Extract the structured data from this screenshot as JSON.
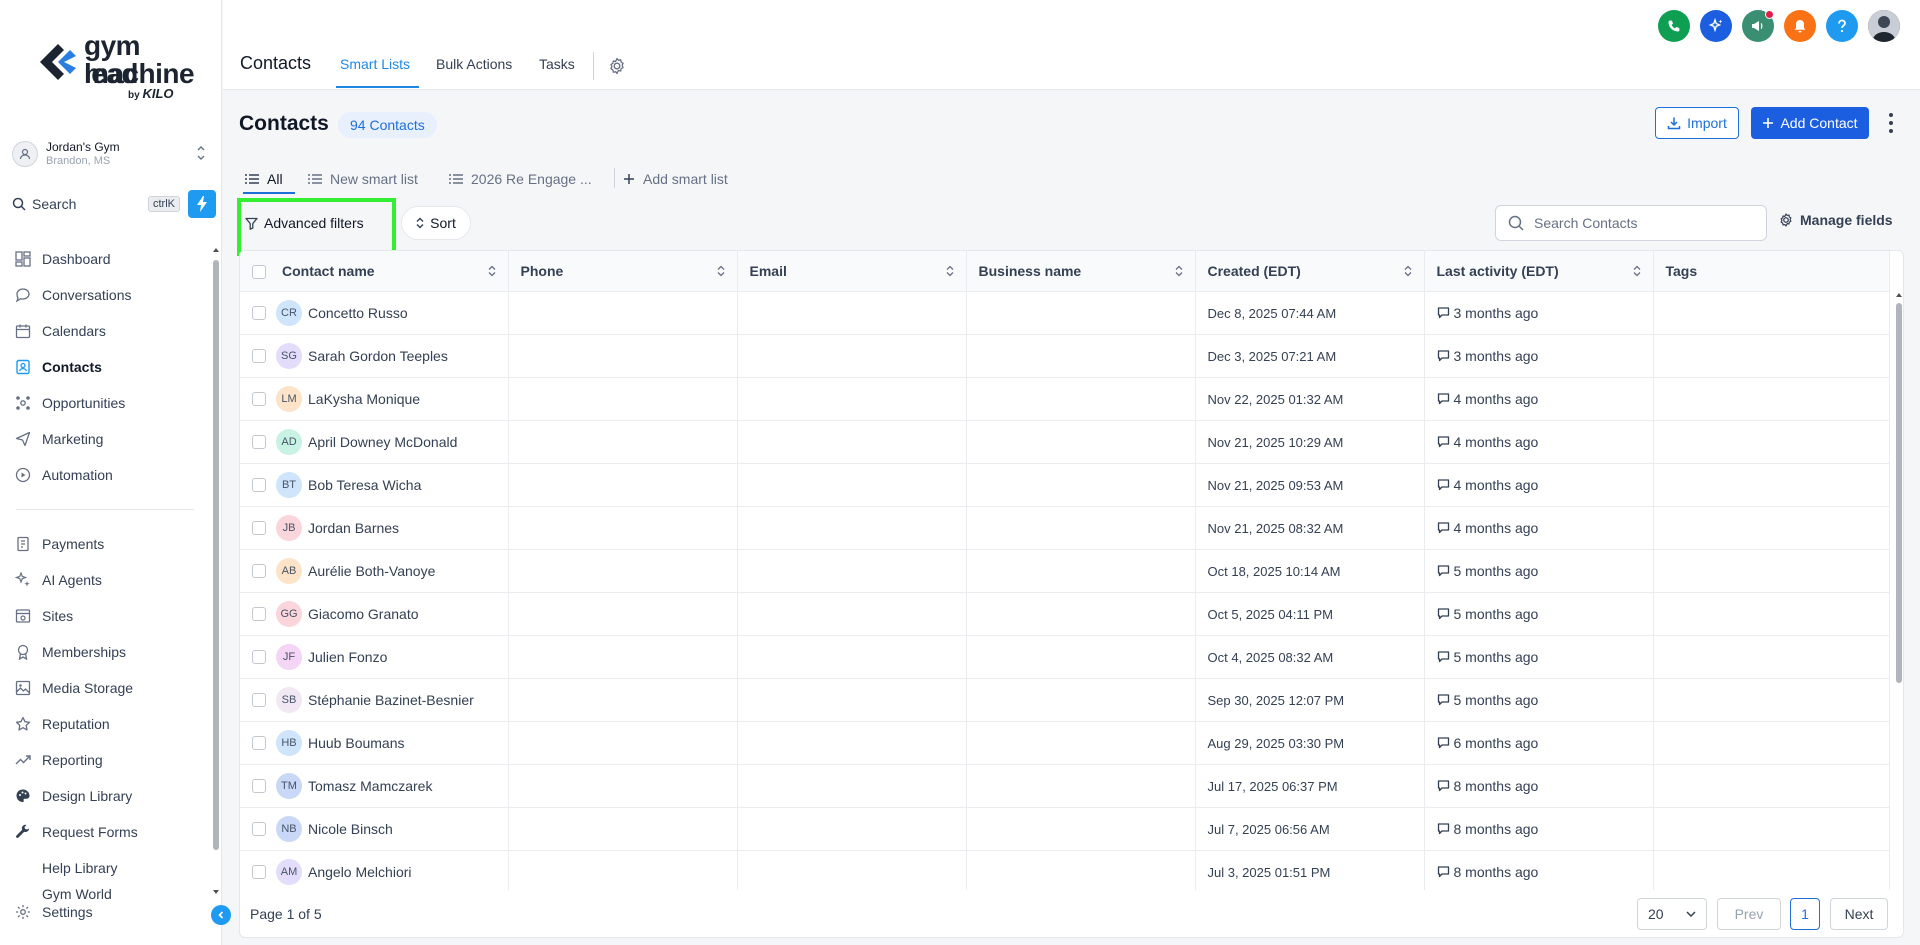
{
  "brand": {
    "line1": "gym lead",
    "line2": "machine",
    "by": "by",
    "by_brand": "KILO"
  },
  "account": {
    "name": "Jordan's Gym",
    "location": "Brandon, MS"
  },
  "sidebar_search": {
    "label": "Search",
    "shortcut": "ctrlK"
  },
  "nav_primary": [
    {
      "label": "Dashboard",
      "icon": "dashboard-icon"
    },
    {
      "label": "Conversations",
      "icon": "chat-icon"
    },
    {
      "label": "Calendars",
      "icon": "calendar-icon"
    },
    {
      "label": "Contacts",
      "icon": "contacts-icon",
      "active": true
    },
    {
      "label": "Opportunities",
      "icon": "opportunities-icon"
    },
    {
      "label": "Marketing",
      "icon": "send-icon"
    },
    {
      "label": "Automation",
      "icon": "automation-icon"
    }
  ],
  "nav_secondary": [
    {
      "label": "Payments",
      "icon": "payments-icon"
    },
    {
      "label": "AI Agents",
      "icon": "ai-agents-icon"
    },
    {
      "label": "Sites",
      "icon": "sites-icon"
    },
    {
      "label": "Memberships",
      "icon": "memberships-icon"
    },
    {
      "label": "Media Storage",
      "icon": "media-icon"
    },
    {
      "label": "Reputation",
      "icon": "star-icon"
    },
    {
      "label": "Reporting",
      "icon": "reporting-icon"
    },
    {
      "label": "Design Library",
      "icon": "palette-icon"
    },
    {
      "label": "Request Forms",
      "icon": "wrench-icon"
    },
    {
      "label": "Help Library",
      "icon": ""
    },
    {
      "label": "Gym World",
      "icon": ""
    }
  ],
  "settings_label": "Settings",
  "topbar": {
    "title": "Contacts",
    "tabs": [
      {
        "label": "Smart Lists",
        "active": true
      },
      {
        "label": "Bulk Actions"
      },
      {
        "label": "Tasks"
      }
    ],
    "icon_colors": [
      "#0e9f53",
      "#1b5fe0",
      "#3a8f73",
      "#f97316",
      "#1e9bf0"
    ]
  },
  "page": {
    "title": "Contacts",
    "count_badge": "94 Contacts",
    "import_label": "Import",
    "add_label": "Add Contact"
  },
  "smart_lists": [
    {
      "label": "All",
      "active": true
    },
    {
      "label": "New smart list"
    },
    {
      "label": "2026 Re Engage ..."
    }
  ],
  "add_smart_list": "Add smart list",
  "filters": {
    "advanced": "Advanced filters",
    "sort": "Sort",
    "search_placeholder": "Search Contacts",
    "manage_fields": "Manage fields"
  },
  "columns": [
    "Contact name",
    "Phone",
    "Email",
    "Business name",
    "Created (EDT)",
    "Last activity (EDT)",
    "Tags"
  ],
  "rows": [
    {
      "initials": "CR",
      "color": "#cfe5fb",
      "name": "Concetto Russo",
      "created": "Dec 8, 2025 07:44 AM",
      "activity": "3 months ago"
    },
    {
      "initials": "SG",
      "color": "#e3ddfb",
      "name": "Sarah Gordon Teeples",
      "created": "Dec 3, 2025 07:21 AM",
      "activity": "3 months ago"
    },
    {
      "initials": "LM",
      "color": "#fde3c8",
      "name": "LaKysha Monique",
      "created": "Nov 22, 2025 01:32 AM",
      "activity": "4 months ago"
    },
    {
      "initials": "AD",
      "color": "#c8f2e3",
      "name": "April Downey McDonald",
      "created": "Nov 21, 2025 10:29 AM",
      "activity": "4 months ago"
    },
    {
      "initials": "BT",
      "color": "#cfe5fb",
      "name": "Bob Teresa Wicha",
      "created": "Nov 21, 2025 09:53 AM",
      "activity": "4 months ago"
    },
    {
      "initials": "JB",
      "color": "#fbd5dc",
      "name": "Jordan Barnes",
      "created": "Nov 21, 2025 08:32 AM",
      "activity": "4 months ago"
    },
    {
      "initials": "AB",
      "color": "#fde3c8",
      "name": "Aurélie Both-Vanoye",
      "created": "Oct 18, 2025 10:14 AM",
      "activity": "5 months ago"
    },
    {
      "initials": "GG",
      "color": "#fbd5dc",
      "name": "Giacomo Granato",
      "created": "Oct 5, 2025 04:11 PM",
      "activity": "5 months ago"
    },
    {
      "initials": "JF",
      "color": "#f5d5f5",
      "name": "Julien Fonzo",
      "created": "Oct 4, 2025 08:32 AM",
      "activity": "5 months ago"
    },
    {
      "initials": "SB",
      "color": "#f1e8f4",
      "name": "Stéphanie Bazinet-Besnier",
      "created": "Sep 30, 2025 12:07 PM",
      "activity": "5 months ago"
    },
    {
      "initials": "HB",
      "color": "#cfe5fb",
      "name": "Huub Boumans",
      "created": "Aug 29, 2025 03:30 PM",
      "activity": "6 months ago"
    },
    {
      "initials": "TM",
      "color": "#c9d8f7",
      "name": "Tomasz Mamczarek",
      "created": "Jul 17, 2025 06:37 PM",
      "activity": "8 months ago"
    },
    {
      "initials": "NB",
      "color": "#c9d8f7",
      "name": "Nicole Binsch",
      "created": "Jul 7, 2025 06:56 AM",
      "activity": "8 months ago"
    },
    {
      "initials": "AM",
      "color": "#e3ddfb",
      "name": "Angelo Melchiori",
      "created": "Jul 3, 2025 01:51 PM",
      "activity": "8 months ago"
    }
  ],
  "pagination": {
    "page_text": "Page 1 of 5",
    "page_size": "20",
    "prev": "Prev",
    "current": "1",
    "next": "Next"
  }
}
